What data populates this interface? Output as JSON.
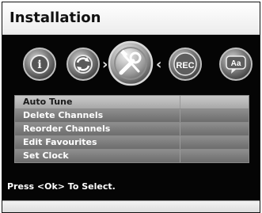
{
  "title": "Installation",
  "icons": [
    {
      "name": "info-icon",
      "text": "i"
    },
    {
      "name": "tuning-icon",
      "text": ""
    },
    {
      "name": "installation-tools-icon",
      "text": ""
    },
    {
      "name": "recording-icon",
      "text": "REC"
    },
    {
      "name": "subtitles-icon",
      "text": "Aa"
    }
  ],
  "arrows": {
    "left": "‹",
    "right": "›"
  },
  "menu": {
    "items": [
      {
        "label": "Auto Tune",
        "selected": true
      },
      {
        "label": "Delete Channels",
        "selected": false
      },
      {
        "label": "Reorder Channels",
        "selected": false
      },
      {
        "label": "Edit Favourites",
        "selected": false
      },
      {
        "label": "Set Clock",
        "selected": false
      }
    ]
  },
  "hint": "Press <Ok> To Select.",
  "colors": {
    "panel": "#050505",
    "menu_item": "#7c7c7c",
    "menu_selected": "#bdbdbd",
    "text_light": "#ffffff",
    "text_dark": "#111111"
  }
}
